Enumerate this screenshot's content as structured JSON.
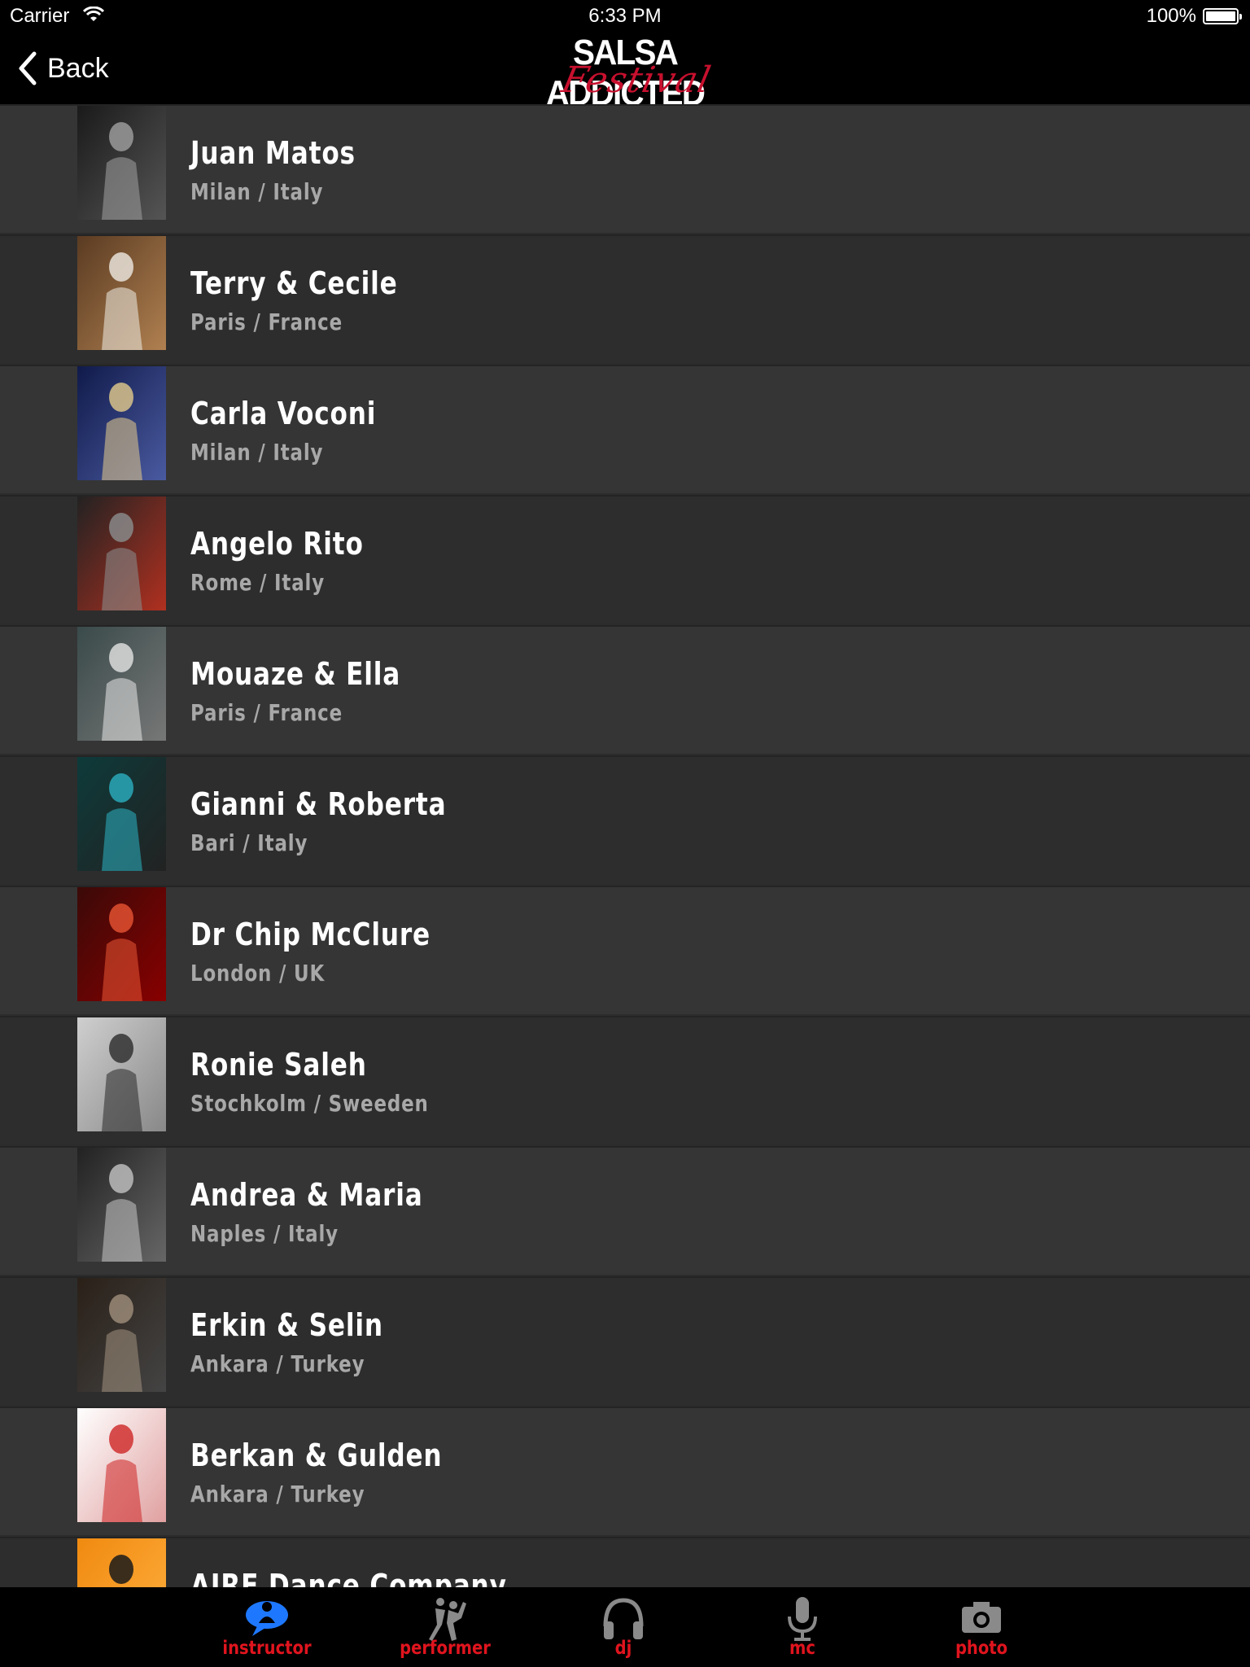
{
  "status_bar": {
    "carrier": "Carrier",
    "time": "6:33 PM",
    "battery": "100%"
  },
  "nav": {
    "back_label": "Back",
    "logo_main": "SALSA ADDICTED",
    "logo_sub": "Festival"
  },
  "instructors": [
    {
      "name": "Juan Matos",
      "city": "Milan / Italy"
    },
    {
      "name": "Terry & Cecile",
      "city": "Paris / France"
    },
    {
      "name": "Carla Voconi",
      "city": "Milan / Italy"
    },
    {
      "name": "Angelo Rito",
      "city": "Rome / Italy"
    },
    {
      "name": "Mouaze & Ella",
      "city": "Paris / France"
    },
    {
      "name": "Gianni & Roberta",
      "city": "Bari / Italy"
    },
    {
      "name": "Dr Chip McClure",
      "city": "London / UK"
    },
    {
      "name": "Ronie Saleh",
      "city": "Stochkolm / Sweeden"
    },
    {
      "name": "Andrea & Maria",
      "city": "Naples / Italy"
    },
    {
      "name": "Erkin & Selin",
      "city": "Ankara / Turkey"
    },
    {
      "name": "Berkan & Gulden",
      "city": "Ankara / Turkey"
    },
    {
      "name": "AIRE Dance Company",
      "city": ""
    }
  ],
  "tabs": [
    {
      "label": "instructor",
      "icon": "instructor-icon",
      "selected": true
    },
    {
      "label": "performer",
      "icon": "performer-icon",
      "selected": false
    },
    {
      "label": "dj",
      "icon": "headphones-icon",
      "selected": false
    },
    {
      "label": "mc",
      "icon": "microphone-icon",
      "selected": false
    },
    {
      "label": "photo",
      "icon": "camera-icon",
      "selected": false
    }
  ],
  "colors": {
    "tab_label": "#e0141e",
    "tab_selected_icon": "#1e78ff",
    "tab_icon": "#8a8a8a",
    "logo_accent": "#c8102e"
  }
}
